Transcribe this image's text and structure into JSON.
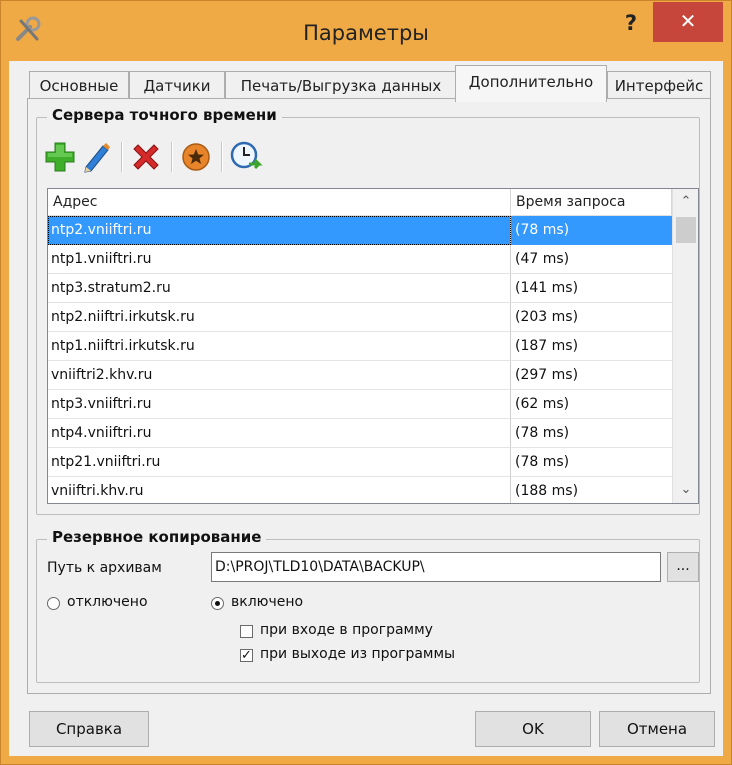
{
  "window": {
    "title": "Параметры",
    "help_label": "?",
    "close_label": "✕"
  },
  "tabs": [
    {
      "label": "Основные"
    },
    {
      "label": "Датчики"
    },
    {
      "label": "Печать/Выгрузка данных"
    },
    {
      "label": "Дополнительно"
    },
    {
      "label": "Интерфейс"
    }
  ],
  "time_servers": {
    "title": "Сервера точного времени",
    "columns": {
      "address": "Адрес",
      "request_time": "Время запроса"
    },
    "rows": [
      {
        "address": "ntp2.vniiftri.ru",
        "time": "(78 ms)"
      },
      {
        "address": "ntp1.vniiftri.ru",
        "time": "(47 ms)"
      },
      {
        "address": "ntp3.stratum2.ru",
        "time": "(141 ms)"
      },
      {
        "address": "ntp2.niiftri.irkutsk.ru",
        "time": "(203 ms)"
      },
      {
        "address": "ntp1.niiftri.irkutsk.ru",
        "time": "(187 ms)"
      },
      {
        "address": "vniiftri2.khv.ru",
        "time": "(297 ms)"
      },
      {
        "address": "ntp3.vniiftri.ru",
        "time": "(62 ms)"
      },
      {
        "address": "ntp4.vniiftri.ru",
        "time": "(78 ms)"
      },
      {
        "address": "ntp21.vniiftri.ru",
        "time": "(78 ms)"
      },
      {
        "address": "vniiftri.khv.ru",
        "time": "(188 ms)"
      }
    ]
  },
  "backup": {
    "title": "Резервное копирование",
    "path_label": "Путь к архивам",
    "path_value": "D:\\PROJ\\TLD10\\DATA\\BACKUP\\",
    "browse_label": "...",
    "radio_off": "отключено",
    "radio_on": "включено",
    "check_on_enter": "при входе в программу",
    "check_on_exit": "при выходе из программы"
  },
  "buttons": {
    "help": "Справка",
    "ok": "OK",
    "cancel": "Отмена"
  }
}
